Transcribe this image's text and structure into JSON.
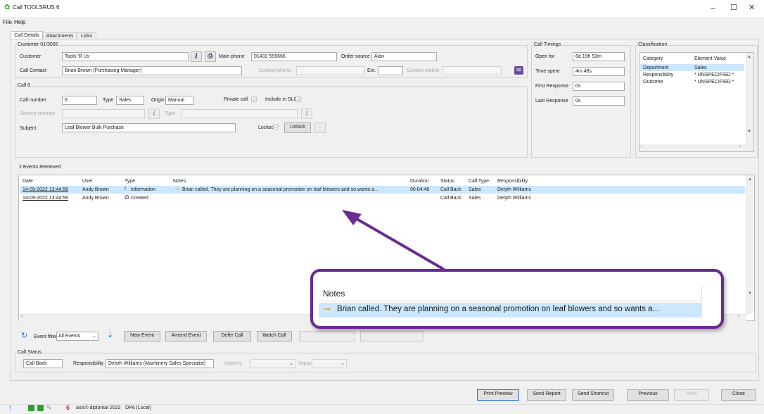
{
  "window": {
    "title": "Call TOOLSRUS 6",
    "min": "–",
    "max": "☐",
    "close": "✕"
  },
  "menu": {
    "file": "File",
    "help": "Help"
  },
  "tabs": [
    "Call Details",
    "Attachments",
    "Links"
  ],
  "customer_group": {
    "title": "Customer 01/3005",
    "customer_label": "Customer",
    "customer_value": "Tools 'R Us",
    "main_phone_label": "Main phone",
    "main_phone_value": "01432 555666",
    "order_source_label": "Order source",
    "order_source_value": "Alan",
    "contact_label": "Call Contact",
    "contact_value": "Brian Brown (Purchasing Manager)",
    "contact_phone_label": "Contact phone",
    "ext_label": "Ext.",
    "contact_mobile_label": "Contact mobile"
  },
  "call_group": {
    "title": "Call 6",
    "number_label": "Call number",
    "number_value": "6",
    "type_label": "Type",
    "type_value": "Sales",
    "origin_label": "Origin",
    "origin_value": "Manual",
    "private_label": "Private call",
    "slo_label": "Include in SLO",
    "service_contract_label": "Service contract",
    "type2_label": "Type",
    "subject_label": "Subject",
    "subject_value": "Leaf Blower Bulk Purchase",
    "locked_label": "Locked",
    "unlock_button": "Unlock",
    "more_button": "..."
  },
  "timings": {
    "title": "Call Timings",
    "open_for_label": "Open for",
    "open_for_value": "6d 19h 53m",
    "time_spent_label": "Time spent",
    "time_spent_value": "4m 48s",
    "first_response_label": "First Response",
    "first_response_value": "0s",
    "last_response_label": "Last Response",
    "last_response_value": "0s"
  },
  "classification": {
    "title": "Classification",
    "col_category": "Category",
    "col_value": "Element Value",
    "rows": [
      {
        "category": "Department",
        "value": "Sales"
      },
      {
        "category": "Responsibility",
        "value": "* UNSPECIFIED *"
      },
      {
        "category": "Outcome",
        "value": "* UNSPECIFIED *"
      }
    ]
  },
  "events": {
    "title": "2 Events Retrieved",
    "columns": [
      "Date",
      "User",
      "Type",
      "Notes",
      "Duration",
      "Status",
      "Call Type",
      "Responsibility"
    ],
    "rows": [
      {
        "date": "14-09-2022 13:44:56",
        "user": "Andy Brown",
        "type": "Information",
        "notes": "Brian called. They are planning on a seasonal promotion on leaf blowers and so wants a...",
        "duration": "00:04:48",
        "status": "Call Back",
        "call_type": "Sales",
        "responsibility": "Delyth Williams"
      },
      {
        "date": "14-09-2022 13:44:56",
        "user": "Andy Brown",
        "type": "Created",
        "notes": "",
        "duration": "",
        "status": "Call Back",
        "call_type": "Sales",
        "responsibility": "Delyth Williams"
      }
    ]
  },
  "callout": {
    "header": "Notes",
    "text": "Brian called. They are planning on a seasonal promotion on leaf blowers and so wants a..."
  },
  "event_toolbar": {
    "filter_label": "Event filter",
    "filter_value": "All Events",
    "new_event": "New Event",
    "amend_event": "Amend Event",
    "defer_call": "Defer Call",
    "watch_call": "Watch Call"
  },
  "call_status": {
    "title": "Call Status",
    "status_value": "Call Back",
    "responsibility_label": "Responsibility",
    "responsibility_value": "Delyth Williams (Machinery Sales Specialist)",
    "urgency_label": "Urgency",
    "impact_label": "Impact"
  },
  "footer_buttons": {
    "print_preview": "Print Preview",
    "send_report": "Send Report",
    "send_shortcut": "Send Shortcut",
    "previous": "Previous",
    "next": "Next",
    "close": "Close"
  },
  "statusbar": {
    "app": "axis® diplomat 2022",
    "db": "DPA (Local)"
  },
  "colors": {
    "accent_purple": "#6a2c91",
    "selection": "#cce8ff",
    "brand_green": "#2e9e2e"
  }
}
